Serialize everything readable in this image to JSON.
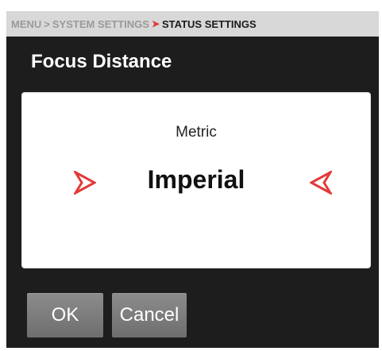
{
  "breadcrumb": {
    "items": [
      "MENU",
      "SYSTEM SETTINGS",
      "STATUS SETTINGS"
    ],
    "separator_gray": ">",
    "separator_red": "➤"
  },
  "title": "Focus Distance",
  "picker": {
    "option_above": "Metric",
    "selected_option": "Imperial"
  },
  "buttons": {
    "ok_label": "OK",
    "cancel_label": "Cancel"
  },
  "colors": {
    "accent": "#e23a3a",
    "background": "#1d1d1d",
    "breadcrumb_bg": "#d8d8d8",
    "button_bg": "#7d7d7d"
  },
  "icons": {
    "left": "arrow-right-pointer-icon",
    "right": "arrow-left-pointer-icon"
  }
}
